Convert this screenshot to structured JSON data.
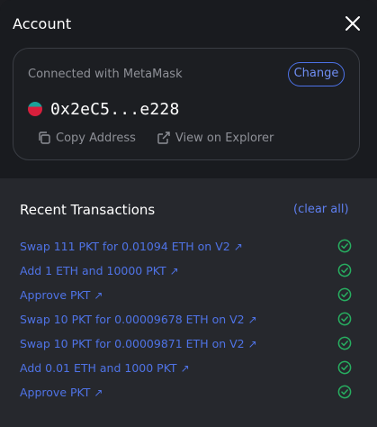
{
  "modal": {
    "title": "Account",
    "close_icon": "close-icon"
  },
  "account": {
    "connected_label": "Connected with MetaMask",
    "change_label": "Change",
    "address": "0x2eC5...e228",
    "copy_label": "Copy Address",
    "explorer_label": "View on Explorer",
    "avatar_colors": [
      "#1aa39a",
      "#d81f3c"
    ]
  },
  "transactions": {
    "title": "Recent Transactions",
    "clear_label": "(clear all)",
    "arrow": "↗",
    "items": [
      {
        "label": "Swap 111 PKT for 0.01094 ETH on V2",
        "status": "success"
      },
      {
        "label": "Add 1 ETH and 10000 PKT",
        "status": "success"
      },
      {
        "label": "Approve PKT",
        "status": "success"
      },
      {
        "label": "Swap 10 PKT for 0.00009678 ETH on V2",
        "status": "success"
      },
      {
        "label": "Swap 10 PKT for 0.00009871 ETH on V2",
        "status": "success"
      },
      {
        "label": "Add 0.01 ETH and 1000 PKT",
        "status": "success"
      },
      {
        "label": "Approve PKT",
        "status": "success"
      }
    ]
  },
  "colors": {
    "accent": "#4f73e6",
    "success": "#27ae60",
    "background": "#191b1f",
    "panel": "#26282d"
  }
}
